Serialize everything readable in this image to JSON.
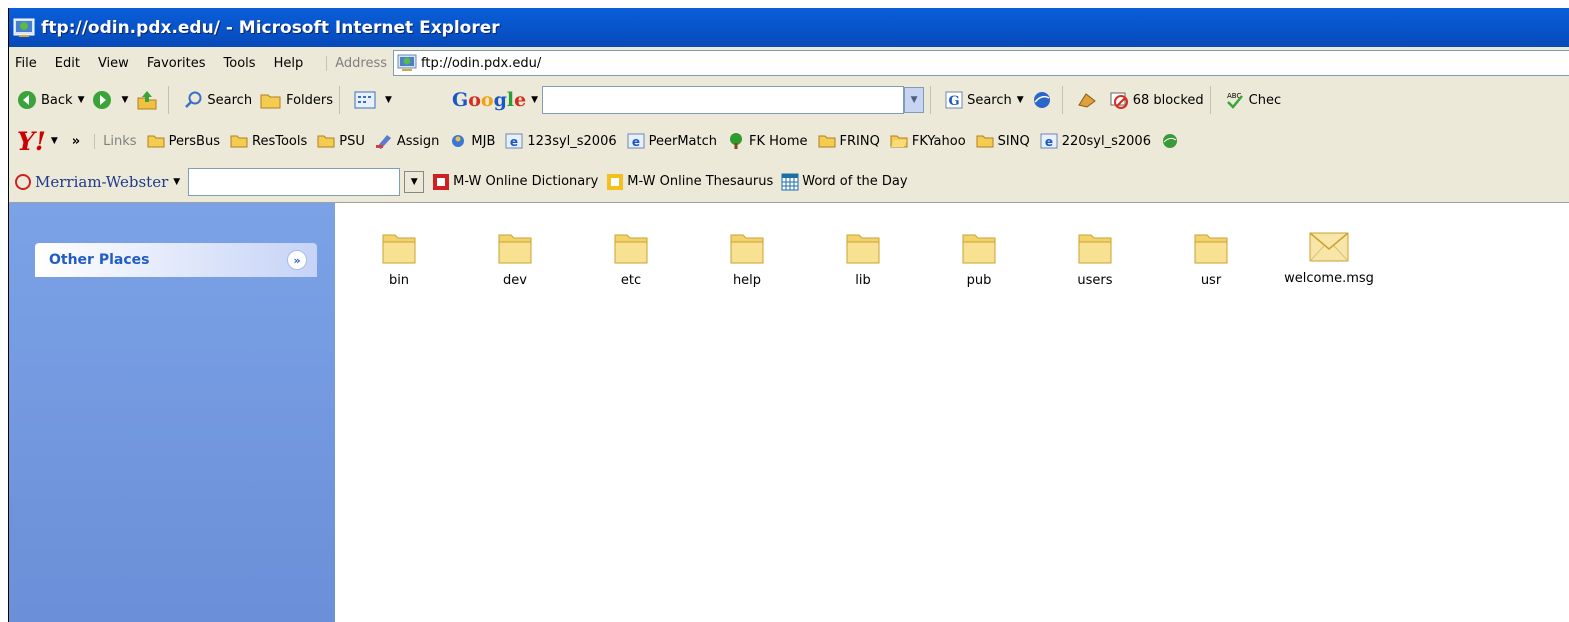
{
  "window": {
    "title": "ftp://odin.pdx.edu/ - Microsoft Internet Explorer"
  },
  "menu": [
    "File",
    "Edit",
    "View",
    "Favorites",
    "Tools",
    "Help"
  ],
  "address": {
    "label": "Address",
    "value": "ftp://odin.pdx.edu/"
  },
  "toolbar": {
    "back": "Back",
    "search": "Search",
    "folders": "Folders"
  },
  "google": {
    "logo_parts": [
      "G",
      "o",
      "o",
      "g",
      "l",
      "e"
    ],
    "search_label": "Search",
    "blocked_label": "68 blocked",
    "check_label": "Chec"
  },
  "links": {
    "label": "Links",
    "items": [
      "PersBus",
      "ResTools",
      "PSU",
      "Assign",
      "MJB",
      "123syl_s2006",
      "PeerMatch",
      "FK Home",
      "FRINQ",
      "FKYahoo",
      "SINQ",
      "220syl_s2006"
    ]
  },
  "yahoo": {
    "logo": "Y!"
  },
  "mw": {
    "logo": "Merriam-Webster",
    "dictionary": "M-W Online Dictionary",
    "thesaurus": "M-W Online Thesaurus",
    "word_of_day": "Word of the Day"
  },
  "taskpane": {
    "other_places": "Other Places"
  },
  "files": [
    "bin",
    "dev",
    "etc",
    "help",
    "lib",
    "pub",
    "users",
    "usr",
    "welcome.msg"
  ],
  "colors": {
    "titlebar": "#0752c8",
    "taskpane": "#7ba2e7",
    "folder": "#f6d870"
  }
}
